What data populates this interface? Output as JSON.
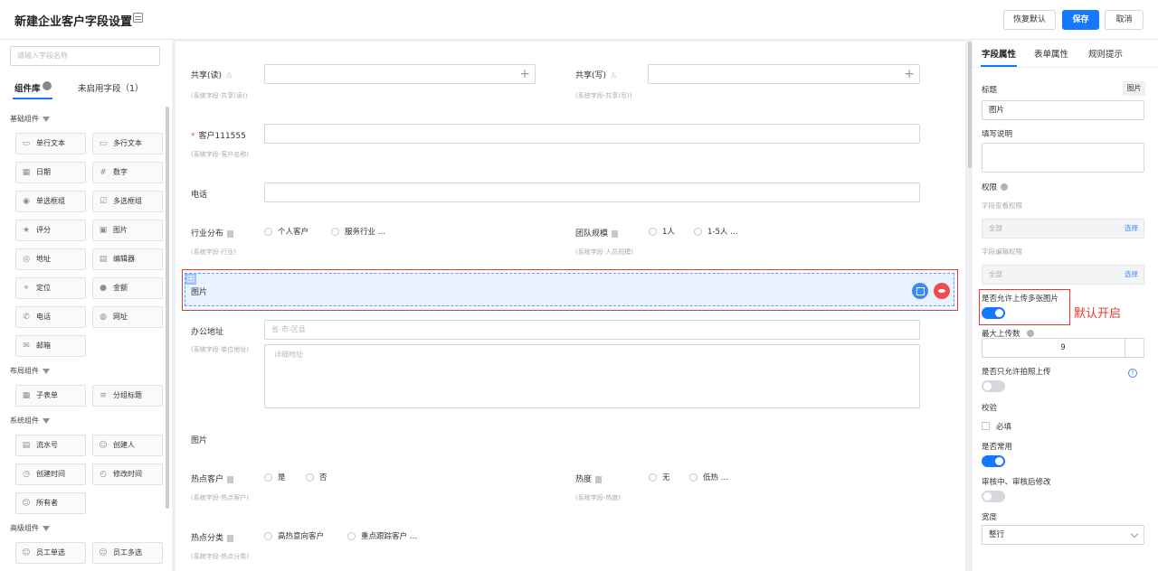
{
  "header": {
    "title": "新建企业客户字段设置",
    "restore_label": "恢复默认",
    "save_label": "保存",
    "cancel_label": "取消"
  },
  "left": {
    "search_placeholder": "请输入字段名称",
    "tab_library": "组件库",
    "tab_unused": "未启用字段（1）",
    "groups": {
      "basic": "基础组件",
      "layout": "布局组件",
      "system": "系统组件",
      "advanced": "高级组件"
    },
    "basic_items": [
      "单行文本",
      "多行文本",
      "日期",
      "数字",
      "单选框组",
      "多选框组",
      "评分",
      "图片",
      "地址",
      "编辑器",
      "定位",
      "金额",
      "电话",
      "网址",
      "邮箱"
    ],
    "layout_items": [
      "子表单",
      "分组标题"
    ],
    "system_items": [
      "流水号",
      "创建人",
      "创建时间",
      "修改时间",
      "所有者"
    ],
    "advanced_items": [
      "员工单选",
      "员工多选"
    ]
  },
  "main": {
    "share_read_label": "共享(读)",
    "share_read_hint": "(系统字段-共享(读))",
    "share_write_label": "共享(写)",
    "share_write_hint": "(系统字段-共享(写))",
    "customer_label": "客户111555",
    "customer_hint": "(系统字段-客户名称)",
    "phone_label": "电话",
    "industry_label": "行业分布",
    "industry_hint": "(系统字段-行业)",
    "industry_opt1": "个人客户",
    "industry_opt2": "服务行业 …",
    "team_label": "团队规模",
    "team_hint": "(系统字段-人员规模)",
    "team_opt1": "1人",
    "team_opt2": "1-5人 …",
    "selected_image_label": "图片",
    "address_label": "办公地址",
    "address_hint": "(系统字段-单位地址)",
    "address_region_placeholder": "省-市-区县",
    "address_detail_placeholder": "详细地址",
    "image2_label": "图片",
    "hot_customer_label": "热点客户",
    "hot_customer_hint": "(系统字段-热点客户)",
    "hot_customer_opt1": "是",
    "hot_customer_opt2": "否",
    "heat_label": "热度",
    "heat_hint": "(系统字段-热度)",
    "heat_opt1": "无",
    "heat_opt2": "低热 …",
    "hot_category_label": "热点分类",
    "hot_category_hint": "(系统字段-热点分类)",
    "hot_category_opt1": "高热意向客户",
    "hot_category_opt2": "重点跟踪客户 …"
  },
  "right": {
    "tab_field": "字段属性",
    "tab_form": "表单属性",
    "tab_rules": "规则提示",
    "title_label": "标题",
    "type_tag": "图片",
    "title_value": "图片",
    "desc_label": "填写说明",
    "perm_label": "权限",
    "view_perm_label": "字段查看权限",
    "view_perm_value": "全部",
    "edit_perm_label": "字段编辑权限",
    "edit_perm_value": "全部",
    "choose_label": "选择",
    "multi_upload_label": "是否允许上传多张图片",
    "multi_upload_on": true,
    "annotation": "默认开启",
    "max_upload_label": "最大上传数",
    "max_upload_value": "9",
    "photo_only_label": "是否只允许拍照上传",
    "photo_only_on": false,
    "validate_label": "校验",
    "required_label": "必填",
    "common_label": "是否常用",
    "common_on": true,
    "review_label": "审核中、审核后修改",
    "review_on": false,
    "width_label": "宽度",
    "width_value": "整行"
  },
  "colors": {
    "primary": "#1677ff",
    "highlight_box": "#e53935"
  }
}
